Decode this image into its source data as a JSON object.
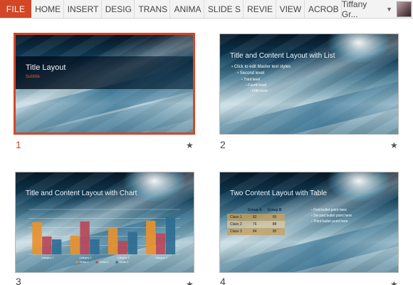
{
  "ribbon": {
    "file_label": "FILE",
    "tabs": [
      "HOME",
      "INSERT",
      "DESIG",
      "TRANS",
      "ANIMA",
      "SLIDE S",
      "REVIE",
      "VIEW",
      "ACROB"
    ],
    "user_name": "Tiffany Gr...",
    "accent_color": "#d24726"
  },
  "slides": [
    {
      "number": "1",
      "selected": true,
      "title": "Title Layout",
      "subtitle": "Subtitle",
      "star": "★"
    },
    {
      "number": "2",
      "title": "Title and Content Layout with List",
      "bullets": [
        "Click to edit Master text styles",
        "Second level",
        "Third level",
        "Fourth level",
        "Fifth level"
      ],
      "star": "★"
    },
    {
      "number": "3",
      "title": "Title and Content Layout with Chart",
      "star": "★"
    },
    {
      "number": "4",
      "title": "Two Content Layout with Table",
      "table": {
        "headers": [
          "",
          "Group A",
          "Group B"
        ],
        "rows": [
          [
            "Class 1",
            "82",
            "95"
          ],
          [
            "Class 2",
            "76",
            "88"
          ],
          [
            "Class 3",
            "84",
            "90"
          ]
        ]
      },
      "bullets": [
        "First bullet point here",
        "Second bullet point here",
        "Third bullet point here"
      ],
      "star": "★"
    }
  ],
  "chart_data": {
    "type": "bar",
    "categories": [
      "Category 1",
      "Category 2",
      "Category 3",
      "Category 4"
    ],
    "series": [
      {
        "name": "Series 1",
        "values": [
          4.3,
          2.5,
          3.5,
          4.5
        ],
        "color": "#e8912c"
      },
      {
        "name": "Series 2",
        "values": [
          2.4,
          4.4,
          1.8,
          2.8
        ],
        "color": "#b8485a"
      },
      {
        "name": "Series 3",
        "values": [
          2.0,
          2.0,
          3.0,
          5.0
        ],
        "color": "#2e6e93"
      }
    ],
    "ylim": [
      0,
      6
    ],
    "grid": true
  }
}
